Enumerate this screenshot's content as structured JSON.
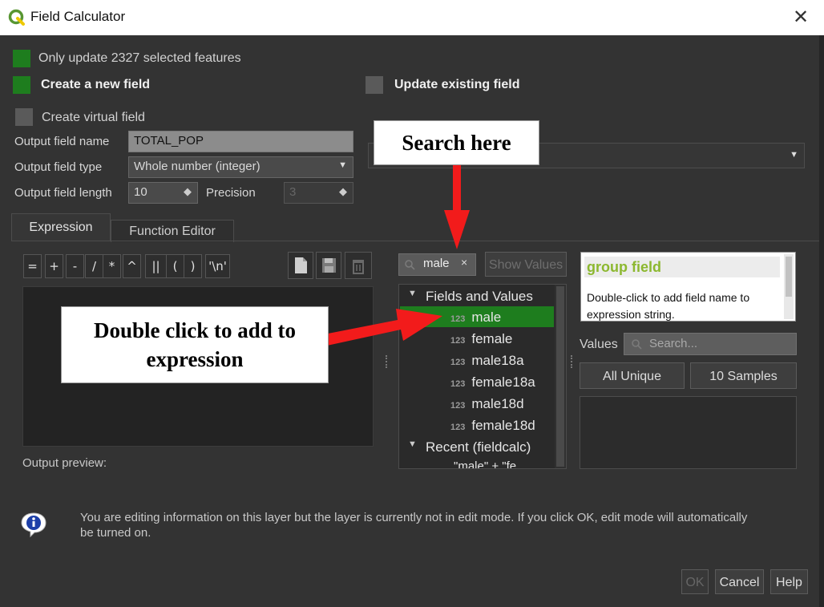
{
  "window": {
    "title": "Field Calculator",
    "close_glyph": "✕"
  },
  "options": {
    "only_update": "Only update 2327 selected features",
    "create_new": "Create a new field",
    "update_existing": "Update existing field",
    "create_virtual": "Create virtual field"
  },
  "form": {
    "name_label": "Output field name",
    "name_value": "TOTAL_POP",
    "type_label": "Output field type",
    "type_value": "Whole number (integer)",
    "length_label": "Output field length",
    "length_value": "10",
    "precision_label": "Precision",
    "precision_value": "3"
  },
  "tabs": [
    "Expression",
    "Function Editor"
  ],
  "operators": [
    "=",
    "+",
    "-",
    "/",
    "*",
    "^",
    "||",
    "(",
    ")",
    "'\\n'"
  ],
  "output_preview_label": "Output preview:",
  "search": {
    "value": "male",
    "clear_glyph": "×",
    "show_values": "Show Values"
  },
  "tree": {
    "group1": "Fields and Values",
    "fields": [
      {
        "type": "123",
        "name": "male"
      },
      {
        "type": "123",
        "name": "female"
      },
      {
        "type": "123",
        "name": "male18a"
      },
      {
        "type": "123",
        "name": "female18a"
      },
      {
        "type": "123",
        "name": "male18d"
      },
      {
        "type": "123",
        "name": "female18d"
      }
    ],
    "group2": "Recent (fieldcalc)",
    "recent_partial": "\"male\" + \"fe"
  },
  "help": {
    "title": "group field",
    "text": "Double-click to add field name to expression string."
  },
  "values": {
    "label": "Values",
    "search_placeholder": "Search...",
    "all_unique": "All Unique",
    "samples": "10 Samples"
  },
  "callouts": {
    "search": "Search here",
    "double_click": "Double click to add to expression"
  },
  "info": {
    "message": "You are editing information on this layer but the layer is currently not in edit mode. If you click OK, edit mode will automatically be turned on."
  },
  "buttons": {
    "ok": "OK",
    "cancel": "Cancel",
    "help": "Help"
  },
  "colors": {
    "accent_green": "#1e7d1e",
    "help_title": "#8cb82f",
    "arrow_red": "#f21b1b"
  }
}
